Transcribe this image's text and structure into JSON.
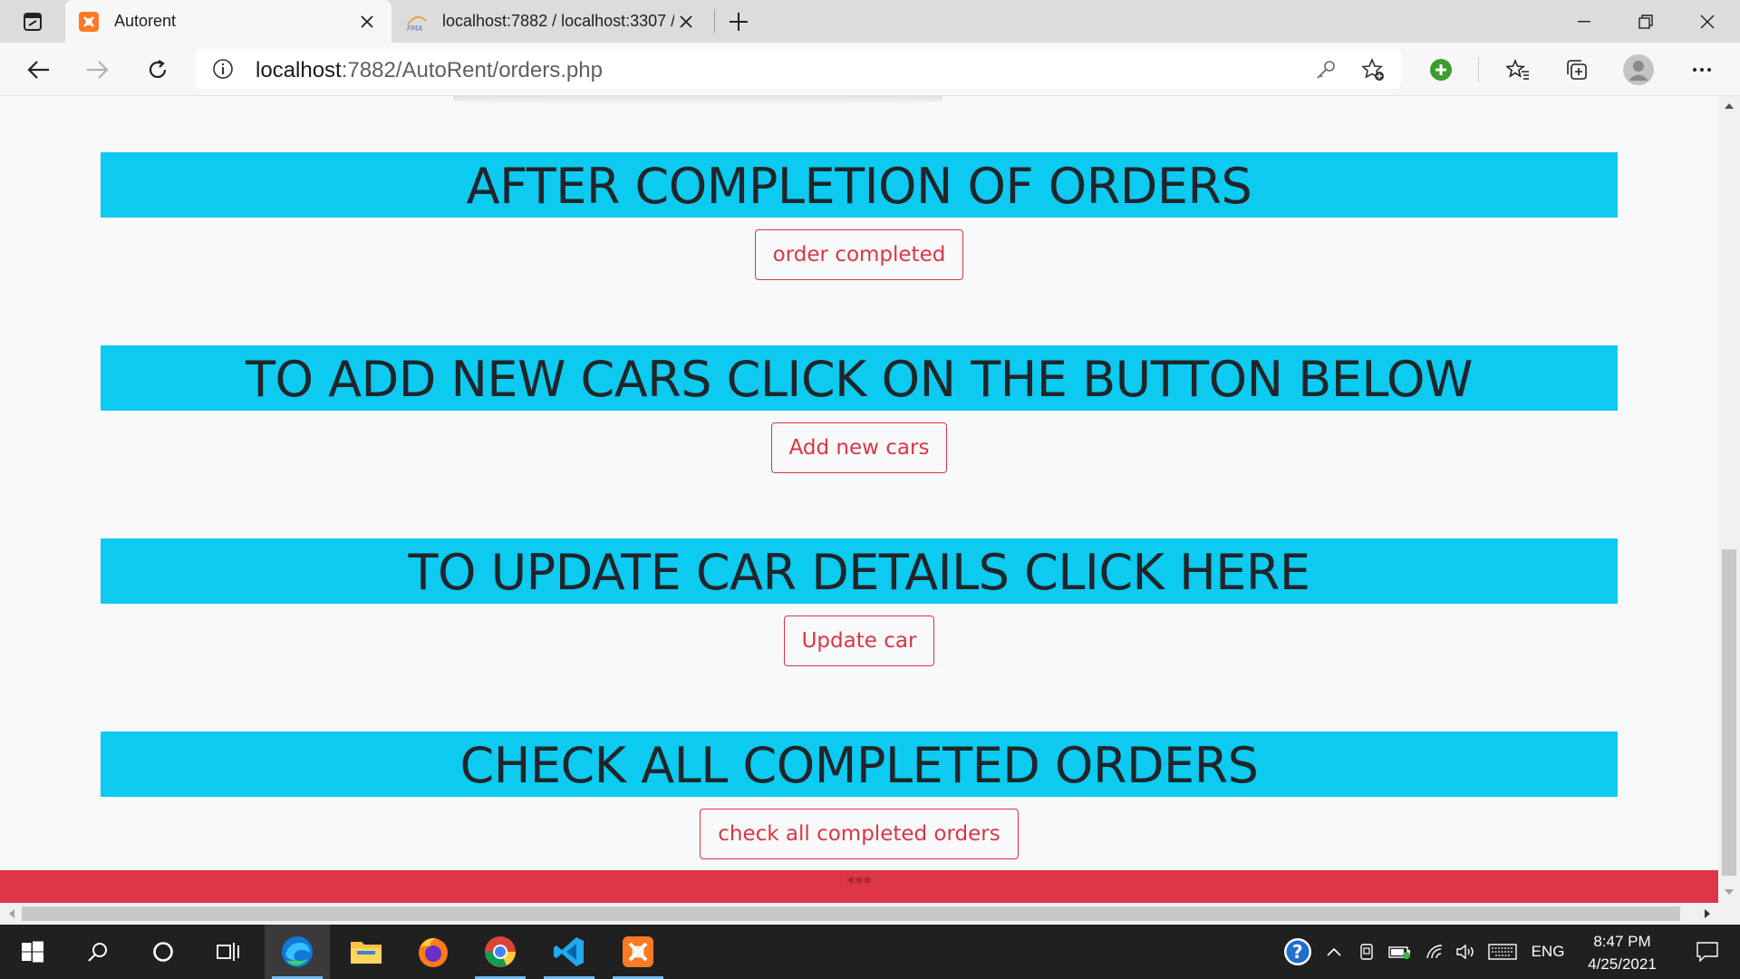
{
  "browser": {
    "tabs": [
      {
        "title": "Autorent",
        "favicon": "xampp-icon",
        "active": true
      },
      {
        "title": "localhost:7882 / localhost:3307 /",
        "favicon": "phpmyadmin-icon",
        "active": false
      }
    ],
    "url_host": "localhost",
    "url_rest": ":7882/AutoRent/orders.php"
  },
  "page": {
    "sections": [
      {
        "heading": "AFTER COMPLETION OF ORDERS",
        "button": "order completed"
      },
      {
        "heading": "TO ADD NEW CARS CLICK ON THE BUTTON BELOW",
        "button": "Add new cars"
      },
      {
        "heading": "TO UPDATE CAR DETAILS CLICK HERE",
        "button": "Update car"
      },
      {
        "heading": "CHECK ALL COMPLETED ORDERS",
        "button": "check all completed orders"
      }
    ],
    "footer_text": "***"
  },
  "taskbar": {
    "language": "ENG",
    "time": "8:47 PM",
    "date": "4/25/2021"
  },
  "colors": {
    "banner": "#0dcaf0",
    "button_outline": "#dc3545",
    "footer": "#dc3545"
  }
}
